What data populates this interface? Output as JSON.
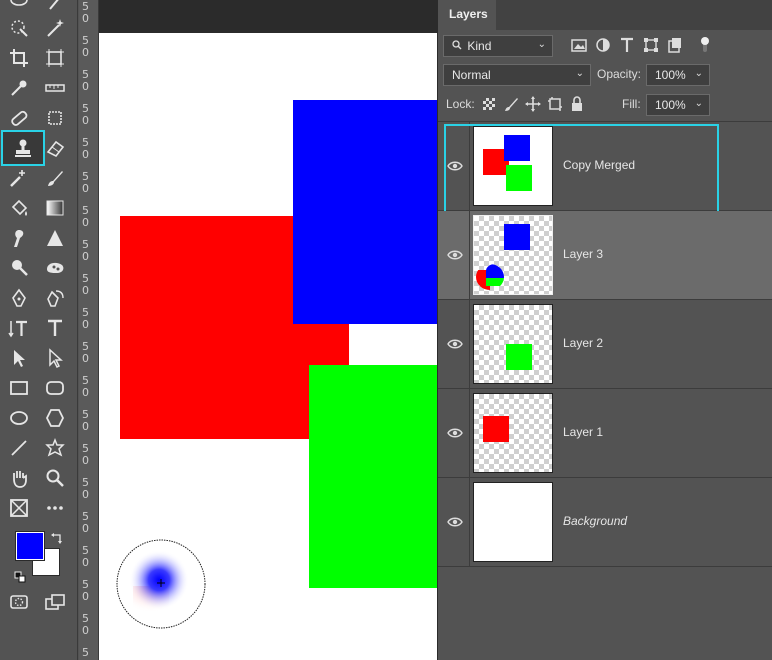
{
  "toolbar": {
    "active_tool": "clone-stamp-tool",
    "foreground_color": "#0000ff",
    "background_color": "#ffffff"
  },
  "ruler": {
    "marks": [
      "5",
      "0"
    ]
  },
  "canvas": {
    "background": "#ffffff"
  },
  "layers_panel": {
    "tab_label": "Layers",
    "filter": {
      "value": "Kind"
    },
    "blend_mode": {
      "value": "Normal"
    },
    "opacity": {
      "label": "Opacity:",
      "value": "100%"
    },
    "lock": {
      "label": "Lock:"
    },
    "fill": {
      "label": "Fill:",
      "value": "100%"
    },
    "layers": [
      {
        "name": "Copy Merged",
        "visible": true,
        "selected": false,
        "highlighted": true
      },
      {
        "name": "Layer 3",
        "visible": true,
        "selected": true,
        "highlighted": false
      },
      {
        "name": "Layer 2",
        "visible": true,
        "selected": false,
        "highlighted": false
      },
      {
        "name": "Layer 1",
        "visible": true,
        "selected": false,
        "highlighted": false
      },
      {
        "name": "Background",
        "visible": true,
        "selected": false,
        "highlighted": false
      }
    ]
  },
  "colors": {
    "accent": "#2ad2e6",
    "red": "#ff0000",
    "green": "#00ff00",
    "blue": "#0000ff"
  }
}
